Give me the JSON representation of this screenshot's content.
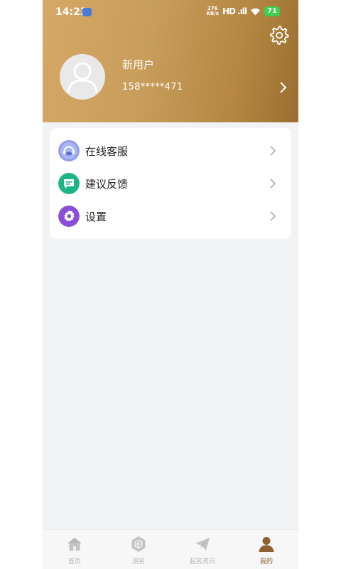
{
  "status_bar": {
    "time": "14:23",
    "net_speed_top": "276",
    "net_speed_bottom": "KB/s",
    "signal": "HD .ıll",
    "battery": "71"
  },
  "profile": {
    "username": "新用户",
    "phone": "158*****471"
  },
  "menu": [
    {
      "label": "在线客服",
      "icon": "headset-icon",
      "color": "#7b8de8"
    },
    {
      "label": "建议反馈",
      "icon": "feedback-icon",
      "color": "#1db585"
    },
    {
      "label": "设置",
      "icon": "settings-icon",
      "color": "#8a4fd6"
    }
  ],
  "tabbar": [
    {
      "label": "首页",
      "icon": "home-icon",
      "active": false
    },
    {
      "label": "测名",
      "icon": "name-test-icon",
      "active": false
    },
    {
      "label": "起名资讯",
      "icon": "paper-plane-icon",
      "active": false
    },
    {
      "label": "我的",
      "icon": "person-icon",
      "active": true
    }
  ],
  "colors": {
    "header_gradient_start": "#d6a866",
    "header_gradient_end": "#9a6e2f",
    "active_tab": "#8c6330"
  }
}
